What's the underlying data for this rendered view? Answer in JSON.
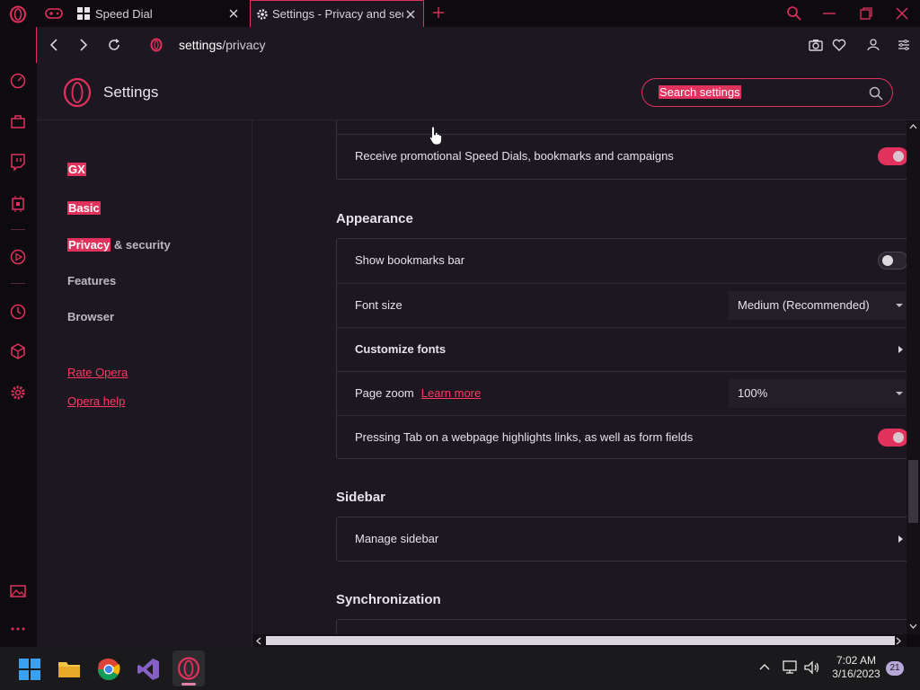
{
  "browser": {
    "tabs": [
      {
        "label": "Speed Dial"
      },
      {
        "label": "Settings - Privacy and security"
      }
    ],
    "address": {
      "prefix": "settings",
      "path": "/privacy"
    }
  },
  "settings_header": {
    "title": "Settings",
    "search_placeholder": "Search settings"
  },
  "nav": {
    "gx": "GX",
    "basic": "Basic",
    "privacy_hl": "Privacy",
    "privacy_rest": " & security",
    "features": "Features",
    "browser": "Browser",
    "rate": "Rate Opera",
    "help": "Opera help"
  },
  "content": {
    "promo_label": "Receive promotional Speed Dials, bookmarks and campaigns",
    "appearance": {
      "heading": "Appearance",
      "bookmarks_bar": "Show bookmarks bar",
      "font_size_label": "Font size",
      "font_size_value": "Medium (Recommended)",
      "customize_fonts": "Customize fonts",
      "page_zoom_label": "Page zoom",
      "learn_more": "Learn more",
      "page_zoom_value": "100%",
      "tab_highlight": "Pressing Tab on a webpage highlights links, as well as form fields"
    },
    "sidebar": {
      "heading": "Sidebar",
      "manage": "Manage sidebar"
    },
    "sync": {
      "heading": "Synchronization"
    }
  },
  "toggles": {
    "promo": true,
    "bookmarks_bar": false,
    "tab_highlight": true
  },
  "taskbar": {
    "time": "7:02 AM",
    "date": "3/16/2023",
    "notifications": "21"
  },
  "colors": {
    "accent": "#e0325d",
    "background": "#1c1720"
  }
}
